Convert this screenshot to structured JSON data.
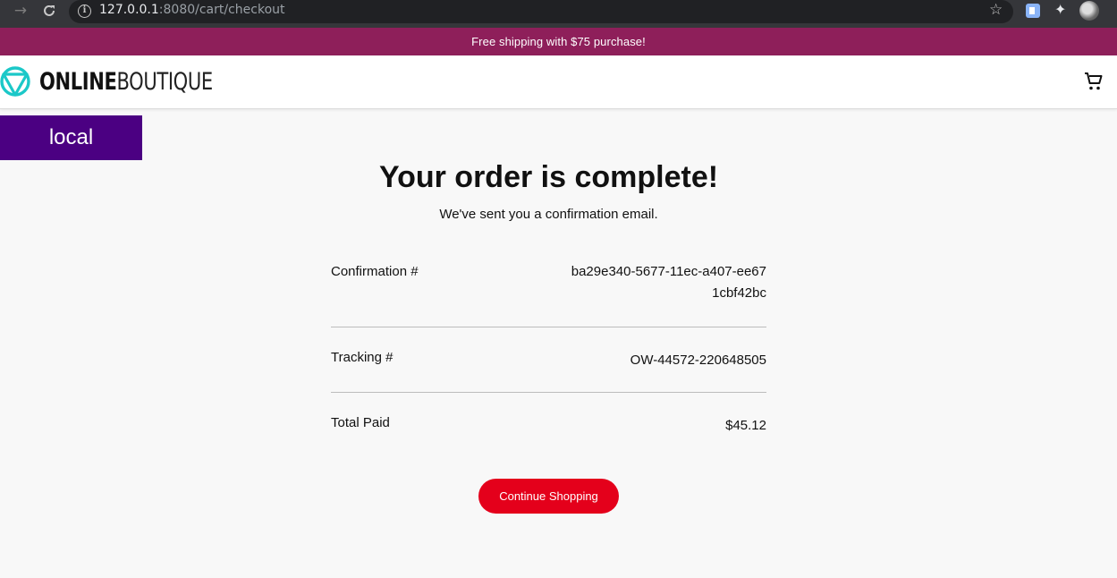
{
  "browser": {
    "url_host": "127.0.0.1",
    "url_rest": ":8080/cart/checkout"
  },
  "promo": {
    "text": "Free shipping with $75 purchase!",
    "color": "#8e1f5a"
  },
  "header": {
    "logo_bold": "ONLINE",
    "logo_thin": "BOUTIQUE",
    "logo_color": "#1bc8c8"
  },
  "env_badge": {
    "label": "local",
    "color": "#4b0082"
  },
  "order": {
    "title": "Your order is complete!",
    "subtitle": "We've sent you a confirmation email.",
    "confirmation_label": "Confirmation #",
    "confirmation_value": "ba29e340-5677-11ec-a407-ee671cbf42bc",
    "tracking_label": "Tracking #",
    "tracking_value": "OW-44572-220648505",
    "total_label": "Total Paid",
    "total_value": "$45.12"
  },
  "actions": {
    "continue_label": "Continue Shopping",
    "accent": "#e4001b"
  }
}
